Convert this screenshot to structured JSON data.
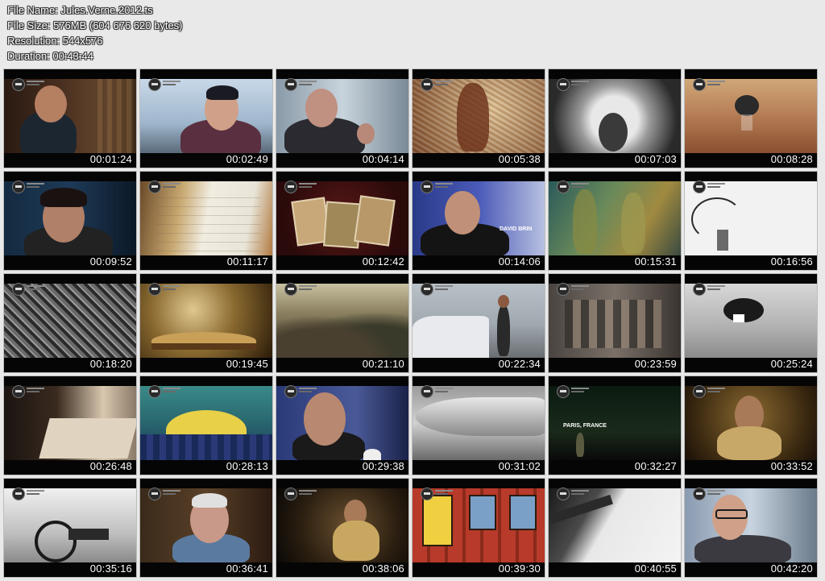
{
  "header": {
    "lines": [
      "File Name: Jules.Verne.2012.ts",
      "File Size: 576MB (604 676 620 bytes)",
      "Resolution: 544x576",
      "Duration: 00:43:44"
    ]
  },
  "thumbnails": [
    {
      "time": "00:01:24"
    },
    {
      "time": "00:02:49"
    },
    {
      "time": "00:04:14"
    },
    {
      "time": "00:05:38"
    },
    {
      "time": "00:07:03"
    },
    {
      "time": "00:08:28"
    },
    {
      "time": "00:09:52"
    },
    {
      "time": "00:11:17"
    },
    {
      "time": "00:12:42"
    },
    {
      "time": "00:14:06",
      "caption": "DAVID BRIN"
    },
    {
      "time": "00:15:31"
    },
    {
      "time": "00:16:56"
    },
    {
      "time": "00:18:20"
    },
    {
      "time": "00:19:45"
    },
    {
      "time": "00:21:10"
    },
    {
      "time": "00:22:34"
    },
    {
      "time": "00:23:59"
    },
    {
      "time": "00:25:24"
    },
    {
      "time": "00:26:48"
    },
    {
      "time": "00:28:13"
    },
    {
      "time": "00:29:38"
    },
    {
      "time": "00:31:02"
    },
    {
      "time": "00:32:27",
      "caption": "PARIS, FRANCE"
    },
    {
      "time": "00:33:52"
    },
    {
      "time": "00:35:16"
    },
    {
      "time": "00:36:41"
    },
    {
      "time": "00:38:06"
    },
    {
      "time": "00:39:30"
    },
    {
      "time": "00:40:55"
    },
    {
      "time": "00:42:20"
    }
  ]
}
